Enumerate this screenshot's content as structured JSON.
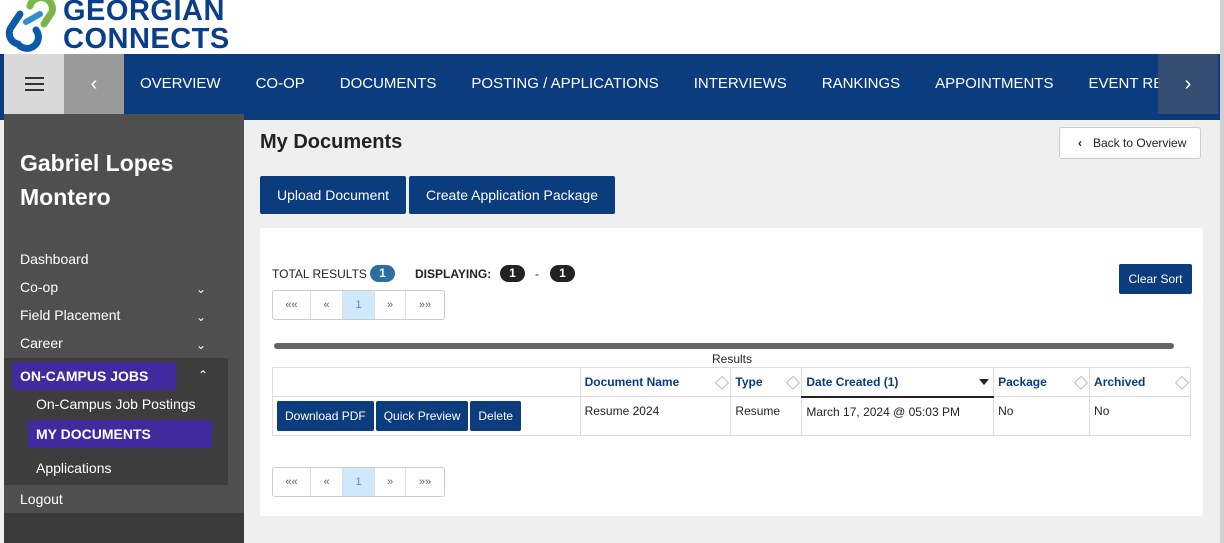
{
  "brand": {
    "line1": "GEORGIAN",
    "line2": "CONNECTS"
  },
  "nav": {
    "items": [
      "OVERVIEW",
      "CO-OP",
      "DOCUMENTS",
      "POSTING / APPLICATIONS",
      "INTERVIEWS",
      "RANKINGS",
      "APPOINTMENTS",
      "EVENT REGISTRATION"
    ]
  },
  "sidebar": {
    "user": {
      "first": "Gabriel Lopes",
      "last": "Montero"
    },
    "items": [
      "Dashboard",
      "Co-op",
      "Field Placement",
      "Career"
    ],
    "section": {
      "title": "ON-CAMPUS JOBS",
      "sub": [
        "On-Campus Job Postings",
        "MY DOCUMENTS",
        "Applications"
      ]
    },
    "logout": "Logout"
  },
  "main": {
    "title": "My Documents",
    "back": "Back to Overview",
    "upload": "Upload Document",
    "create_package": "Create Application Package"
  },
  "results": {
    "total_label": "TOTAL RESULTS",
    "total": "1",
    "displaying_label": "DISPLAYING:",
    "from": "1",
    "dash": "-",
    "to": "1",
    "clear_sort": "Clear Sort",
    "caption": "Results",
    "pager": [
      "««",
      "«",
      "1",
      "»",
      "»»"
    ]
  },
  "table": {
    "headers": [
      "",
      "Document Name",
      "Type",
      "Date Created (1)",
      "Package",
      "Archived"
    ],
    "row": {
      "actions": [
        "Download PDF",
        "Quick Preview",
        "Delete"
      ],
      "name": "Resume 2024",
      "type": "Resume",
      "date": "March 17, 2024 @ 05:03 PM",
      "package": "No",
      "archived": "No"
    }
  },
  "colors": {
    "primary": "#0b3c7e",
    "accent": "#3f2a9e",
    "sidebar": "#4f4f4f",
    "pill": "#2a6fa0"
  }
}
